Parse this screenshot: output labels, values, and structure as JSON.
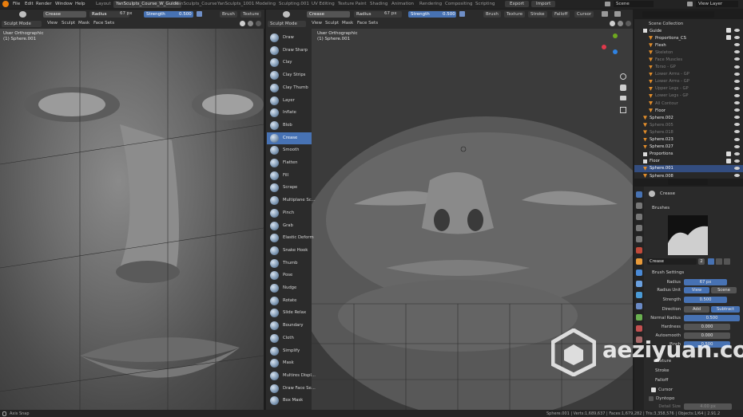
{
  "topbar": {
    "menu": [
      "File",
      "Edit",
      "Render",
      "Window",
      "Help"
    ],
    "tabs": [
      "Layout",
      "YanSculpts_Course_W_Guide",
      "YanSculpts_Course",
      "YanSculpts_1001",
      "Modeling",
      "Sculpting.001",
      "UV Editing",
      "Texture Paint",
      "Shading",
      "Animation",
      "Rendering",
      "Compositing",
      "Scripting"
    ],
    "active_tab": "YanSculpts_Course_W_Guide",
    "export": "Export",
    "import": "Import",
    "scene": "Scene",
    "view_layer": "View Layer"
  },
  "left_header": {
    "brush": "Crease",
    "radius_label": "Radius",
    "radius_value": "67 px",
    "strength_label": "Strength",
    "strength_value": "0.500",
    "brush_menu": "Brush",
    "texture_menu": "Texture"
  },
  "left_header2": {
    "mode": "Sculpt Mode",
    "view": "View",
    "sculpt": "Sculpt",
    "mask": "Mask",
    "face_sets": "Face Sets"
  },
  "left_viewport": {
    "line1": "User Orthographic",
    "line2": "(1) Sphere.001"
  },
  "right_header": {
    "brush": "Crease",
    "radius_label": "Radius",
    "radius_value": "67 px",
    "strength_label": "Strength",
    "strength_value": "0.500",
    "brush_menu": "Brush",
    "texture_menu": "Texture",
    "stroke_menu": "Stroke",
    "falloff_menu": "Falloff",
    "cursor_menu": "Cursor"
  },
  "right_header2": {
    "mode": "Sculpt Mode",
    "view": "View",
    "sculpt": "Sculpt",
    "mask": "Mask",
    "face_sets": "Face Sets"
  },
  "right_viewport": {
    "line1": "User Orthographic",
    "line2": "(1) Sphere.001"
  },
  "tools": [
    "Draw",
    "Draw Sharp",
    "Clay",
    "Clay Strips",
    "Clay Thumb",
    "Layer",
    "Inflate",
    "Blob",
    "Crease",
    "Smooth",
    "Flatten",
    "Fill",
    "Scrape",
    "Multiplane Sc...",
    "Pinch",
    "Grab",
    "Elastic Deform",
    "Snake Hook",
    "Thumb",
    "Pose",
    "Nudge",
    "Rotate",
    "Slide Relax",
    "Boundary",
    "Cloth",
    "Simplify",
    "Mask",
    "Multires Displ...",
    "Draw Face Se...",
    "Box Mask"
  ],
  "selected_tool": "Crease",
  "outliner": {
    "root": "Scene Collection",
    "items": [
      {
        "name": "Guide",
        "indent": 1,
        "color": "#e6e6e6",
        "type": "collection"
      },
      {
        "name": "Proportions_CS",
        "indent": 2,
        "color": "#e6e6e6",
        "type": "mesh"
      },
      {
        "name": "Flesh",
        "indent": 2,
        "color": "#e6e6e6",
        "type": "mesh"
      },
      {
        "name": "Skeleton",
        "indent": 2,
        "color": "#7a7a7a",
        "type": "mesh"
      },
      {
        "name": "Face Muscles",
        "indent": 2,
        "color": "#7a7a7a",
        "type": "mesh"
      },
      {
        "name": "Torso - GP",
        "indent": 2,
        "color": "#7a7a7a",
        "type": "mesh"
      },
      {
        "name": "Lower Arms - GP",
        "indent": 2,
        "color": "#7a7a7a",
        "type": "mesh"
      },
      {
        "name": "Lower Arms - GP",
        "indent": 2,
        "color": "#7a7a7a",
        "type": "mesh"
      },
      {
        "name": "Upper Legs - GP",
        "indent": 2,
        "color": "#7a7a7a",
        "type": "mesh"
      },
      {
        "name": "Lower Legs - GP",
        "indent": 2,
        "color": "#7a7a7a",
        "type": "mesh"
      },
      {
        "name": "All Contour",
        "indent": 2,
        "color": "#7a7a7a",
        "type": "mesh"
      },
      {
        "name": "Floor",
        "indent": 2,
        "color": "#e6e6e6",
        "type": "mesh"
      },
      {
        "name": "Sphere.002",
        "indent": 1,
        "color": "#e6e6e6",
        "type": "mesh"
      },
      {
        "name": "Sphere.005",
        "indent": 1,
        "color": "#7a7a7a",
        "type": "mesh"
      },
      {
        "name": "Sphere.018",
        "indent": 1,
        "color": "#7a7a7a",
        "type": "mesh"
      },
      {
        "name": "Sphere.023",
        "indent": 1,
        "color": "#e6e6e6",
        "type": "mesh"
      },
      {
        "name": "Sphere.027",
        "indent": 1,
        "color": "#e6e6e6",
        "type": "mesh"
      },
      {
        "name": "Proportions",
        "indent": 1,
        "color": "#e6e6e6",
        "type": "collection"
      },
      {
        "name": "Floor",
        "indent": 1,
        "color": "#e6e6e6",
        "type": "collection"
      },
      {
        "name": "Sphere.001",
        "indent": 1,
        "color": "#ffffff",
        "type": "mesh",
        "selected": true
      },
      {
        "name": "Sphere.008",
        "indent": 1,
        "color": "#e6e6e6",
        "type": "mesh"
      }
    ]
  },
  "properties": {
    "brush_name": "Crease",
    "brushes_title": "Brushes",
    "brush_field": "Crease",
    "brush_users": "2",
    "brush_settings_title": "Brush Settings",
    "radius_label": "Radius",
    "radius_value": "67 px",
    "radius_unit_label": "Radius Unit",
    "radius_unit_view": "View",
    "radius_unit_scene": "Scene",
    "strength_label": "Strength",
    "strength_value": "0.500",
    "direction_label": "Direction",
    "direction_add": "Add",
    "direction_subtract": "Subtract",
    "normal_radius_label": "Normal Radius",
    "normal_radius_value": "0.500",
    "hardness_label": "Hardness",
    "hardness_value": "0.000",
    "autosmooth_label": "Autosmooth",
    "autosmooth_value": "0.000",
    "pinch_label": "Pinch",
    "pinch_value": "0.500",
    "texture": "Texture",
    "stroke": "Stroke",
    "falloff": "Falloff",
    "cursor": "Cursor",
    "dyntopo": "Dyntopo",
    "detail_size_label": "Detail Size",
    "detail_size_value": "4.00 px"
  },
  "statusbar": {
    "left": "Axis Snap",
    "right": "Sphere.001 | Verts:1,689,637 | Faces:1,679,282 | Tris:3,358,576 | Objects:1/64 | 2.91.2"
  },
  "watermark": "aeziyuan.com",
  "colors": {
    "accent": "#4772b3",
    "bg": "#1d1d1d",
    "panel": "#2b2b2b"
  }
}
